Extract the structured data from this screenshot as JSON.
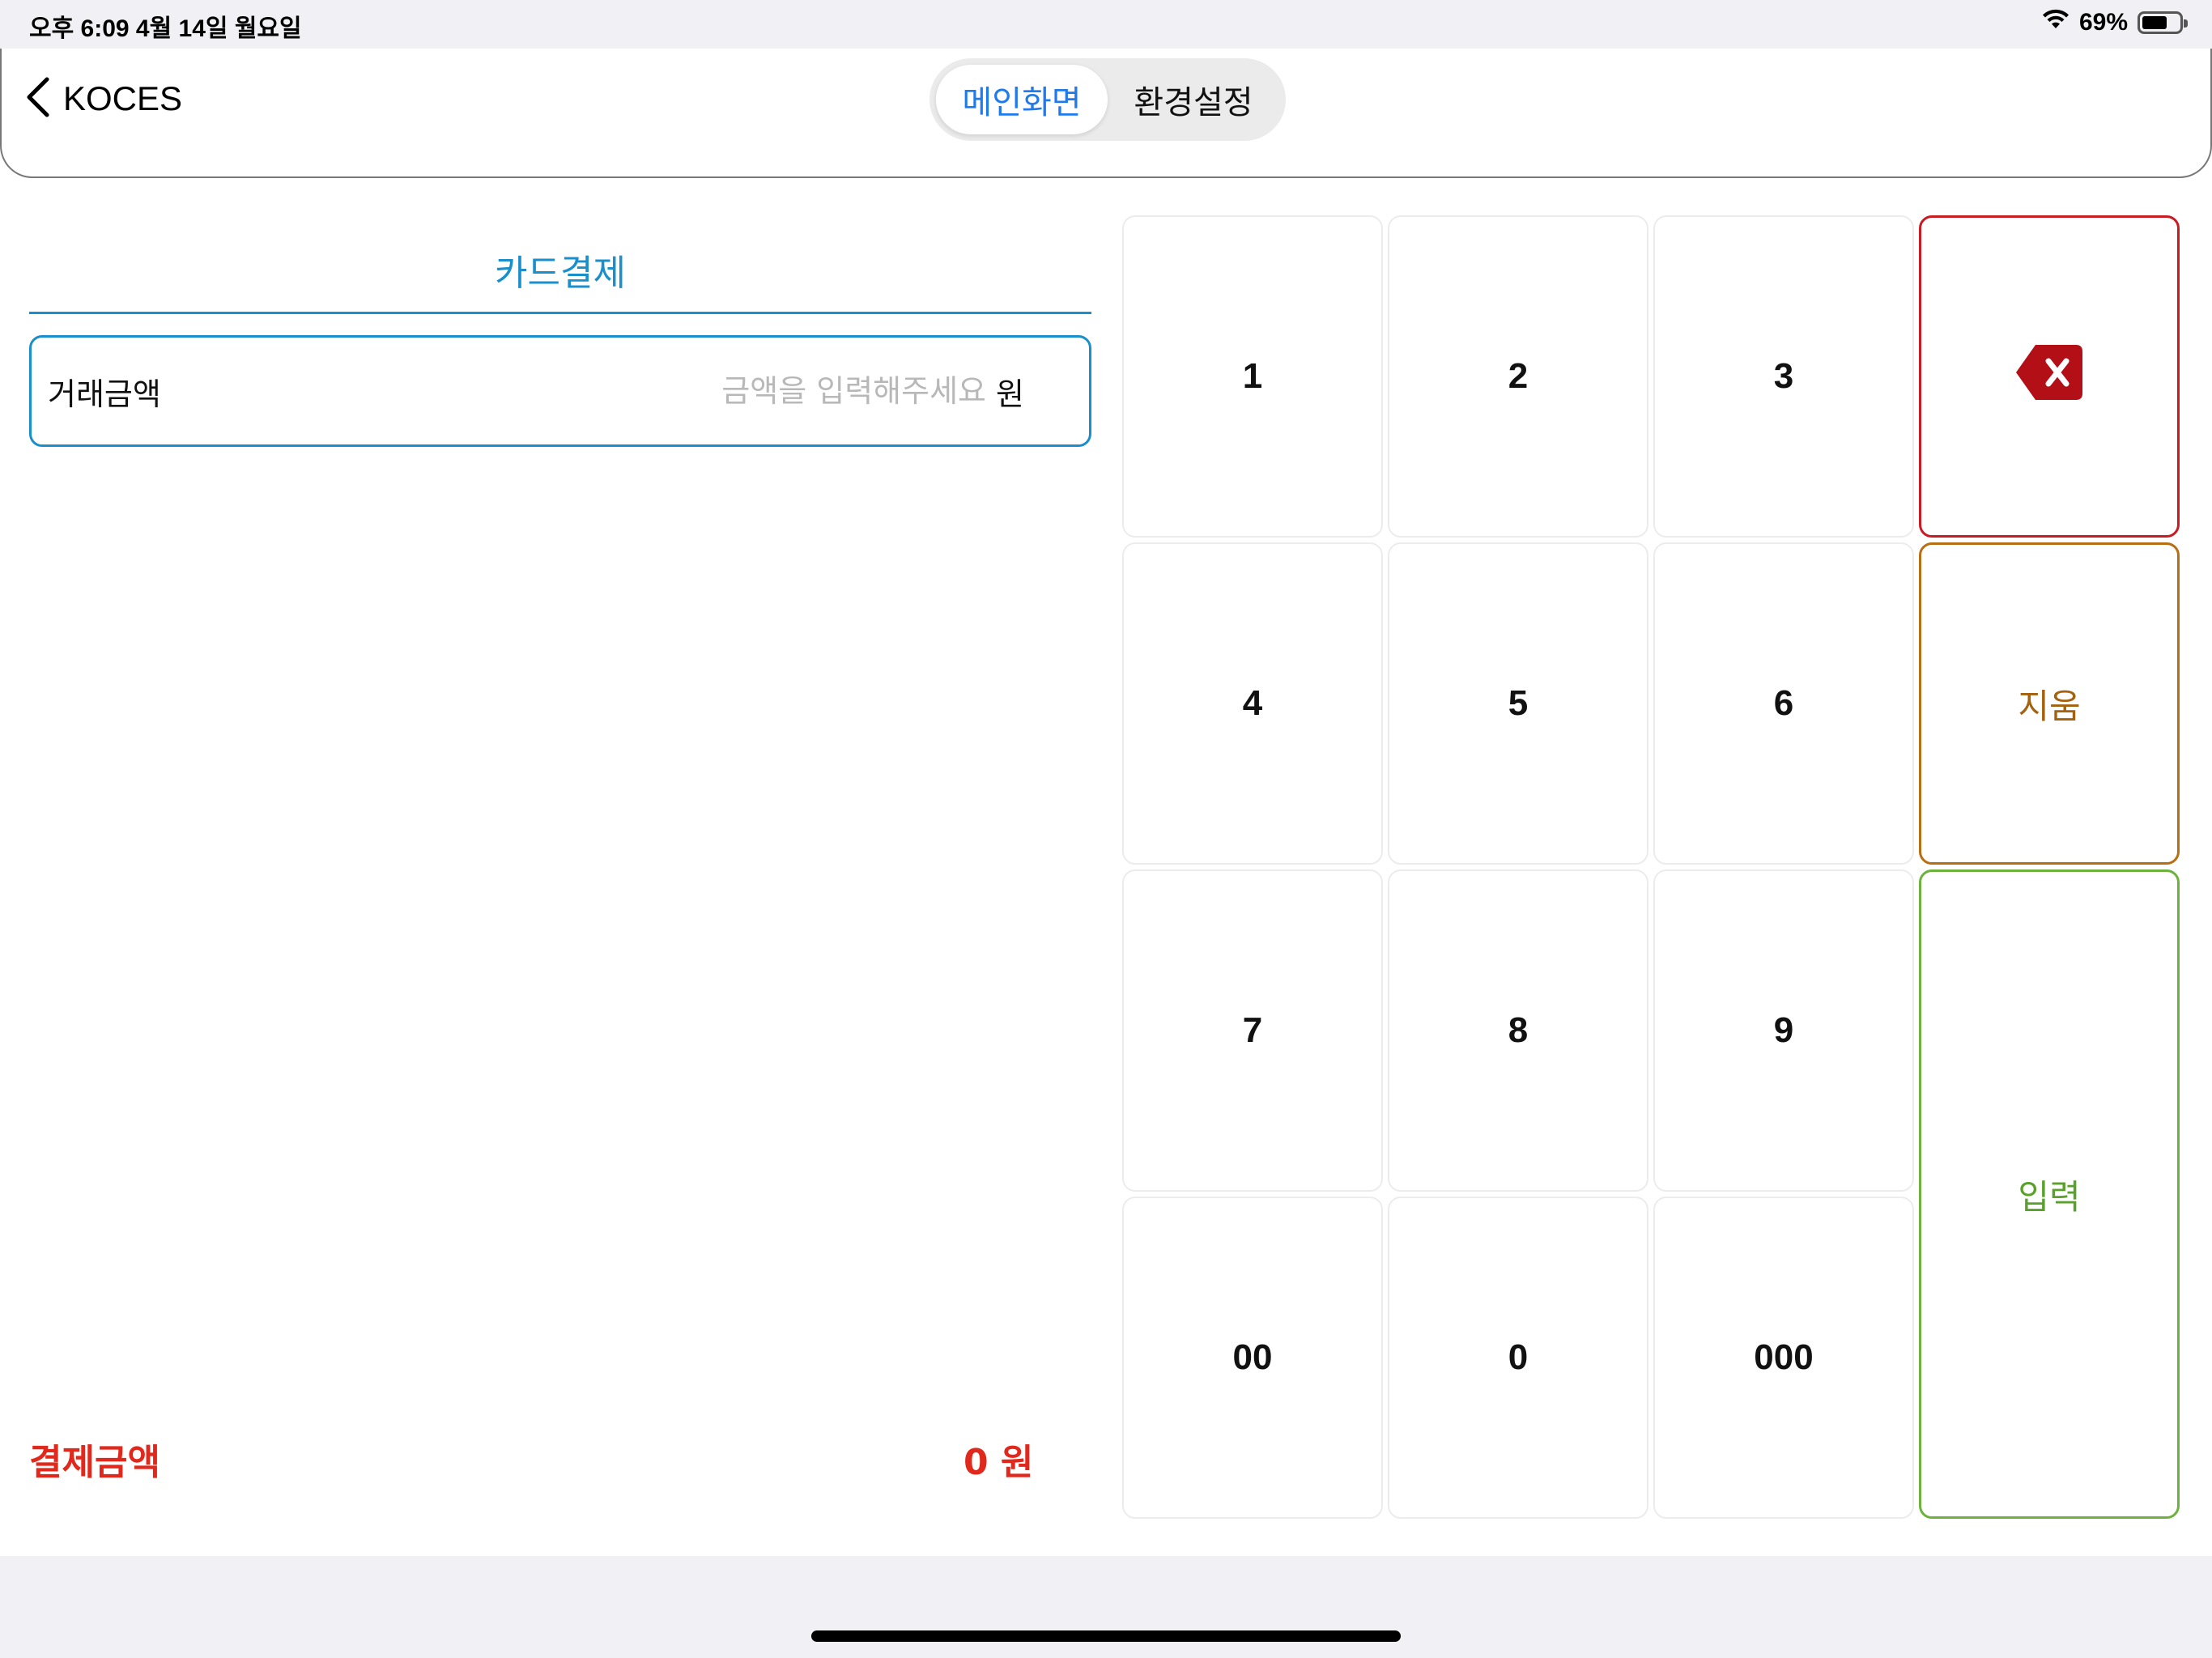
{
  "status_bar": {
    "time": "오후 6:09   4월 14일 월요일",
    "battery": "69%",
    "battery_level": 0.69,
    "wifi_icon": "wifi-icon",
    "battery_icon": "battery-icon"
  },
  "nav": {
    "back_label": "KOCES",
    "back_icon": "chevron-left-icon",
    "tabs": [
      {
        "label": "메인화면",
        "active": true
      },
      {
        "label": "환경설정",
        "active": false
      }
    ]
  },
  "payment": {
    "title": "카드결제",
    "amount_label": "거래금액",
    "amount_placeholder": "금액을 입력해주세요",
    "amount_value": "",
    "amount_unit": "원",
    "total_label": "결제금액",
    "total_value": "0 원"
  },
  "keypad": {
    "keys": [
      "1",
      "2",
      "3",
      "4",
      "5",
      "6",
      "7",
      "8",
      "9",
      "00",
      "0",
      "000"
    ],
    "backspace_icon": "backspace-icon",
    "clear_label": "지움",
    "enter_label": "입력"
  },
  "colors": {
    "accent_blue": "#1a8fcb",
    "tab_active": "#1f7aec",
    "total_red": "#e0281c",
    "backspace_red": "#c81c22",
    "clear_orange": "#b86e12",
    "enter_green": "#6cb23c"
  }
}
